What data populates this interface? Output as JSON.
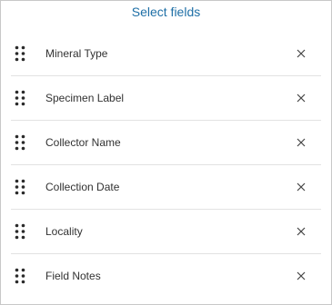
{
  "header": {
    "title": "Select fields"
  },
  "fields": [
    {
      "label": "Mineral Type"
    },
    {
      "label": "Specimen Label"
    },
    {
      "label": "Collector Name"
    },
    {
      "label": "Collection Date"
    },
    {
      "label": "Locality"
    },
    {
      "label": "Field Notes"
    }
  ],
  "icons": {
    "drag": "drag-handle-icon",
    "remove": "close-icon"
  },
  "colors": {
    "link": "#1e6fa6",
    "text": "#323232",
    "divider": "#e2e2e2",
    "border": "#c8c8c8"
  }
}
